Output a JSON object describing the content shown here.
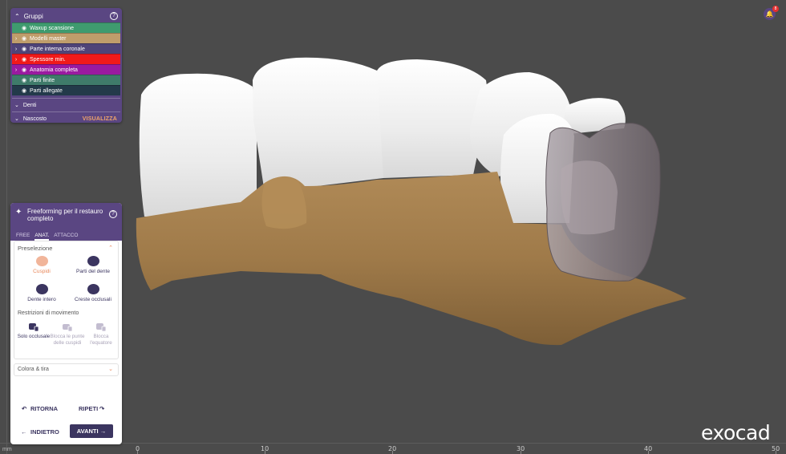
{
  "colors": {
    "panel_purple": "#5a4682",
    "accent_orange": "#e8875a",
    "button_dark": "#3b3560",
    "viewport_bg": "#4b4b4b",
    "tooth_white": "#f2f2f2",
    "gum_tan": "#a37c4b",
    "ghost_crown": "#8c8287"
  },
  "groups_panel": {
    "title": "Gruppi",
    "help_icon": "?",
    "items": [
      {
        "label": "Waxup scansione",
        "color": "#3f9b6f",
        "expand": false
      },
      {
        "label": "Modelli master",
        "color": "#bf9d6b",
        "expand": true
      },
      {
        "label": "Parte interna coronale",
        "color": "#4f4478",
        "expand": true
      },
      {
        "label": "Spessore min.",
        "color": "#f01a1a",
        "expand": true
      },
      {
        "label": "Anatomia completa",
        "color": "#9a1aa0",
        "expand": true
      },
      {
        "label": "Parti finite",
        "color": "#3f7b6a",
        "expand": false
      },
      {
        "label": "Parti allegate",
        "color": "#233a4a",
        "expand": false
      }
    ],
    "denti_label": "Denti",
    "nascosto_label": "Nascosto",
    "visualizza_label": "VISUALIZZA"
  },
  "freeform_panel": {
    "title": "Freeforming per il restauro completo",
    "tabs": [
      {
        "label": "FREE",
        "active": false
      },
      {
        "label": "ANAT.",
        "active": true
      },
      {
        "label": "ATTACCO",
        "active": false
      }
    ],
    "preselection_title": "Preselezione",
    "presets": [
      {
        "label": "Cuspidi",
        "active": true
      },
      {
        "label": "Parti del dente",
        "active": false
      },
      {
        "label": "Dente intero",
        "active": false
      },
      {
        "label": "Creste occlusali",
        "active": false
      }
    ],
    "restrictions_title": "Restrizioni di movimento",
    "restrictions": [
      {
        "label": "Solo occlusale",
        "enabled": true
      },
      {
        "label": "Blocca le punte delle cuspidi",
        "enabled": false
      },
      {
        "label": "Blocca l'equatore",
        "enabled": false
      }
    ],
    "color_row_label": "Colora & tira",
    "undo_label": "RITORNA",
    "redo_label": "RIPETI",
    "back_label": "INDIETRO",
    "next_label": "AVANTI"
  },
  "ruler": {
    "unit": "mm",
    "ticks": [
      "0",
      "10",
      "20",
      "30",
      "40",
      "50"
    ]
  },
  "notification": {
    "count": "8"
  },
  "logo": "exocad"
}
